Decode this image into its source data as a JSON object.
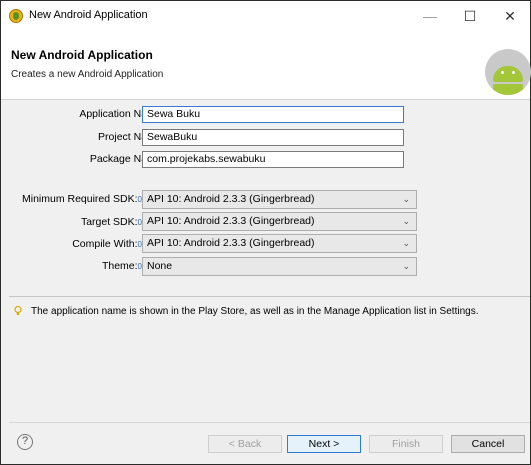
{
  "window": {
    "title": "New Android Application"
  },
  "header": {
    "title": "New Android Application",
    "subtitle": "Creates a new Android Application"
  },
  "form": {
    "app_name_label": "Application Name:",
    "app_name_value": "Sewa Buku",
    "project_name_label": "Project Name:",
    "project_name_value": "SewaBuku",
    "package_name_label": "Package Name:",
    "package_name_value": "com.projekabs.sewabuku",
    "min_sdk_label": "Minimum Required SDK:",
    "min_sdk_value": "API 10: Android 2.3.3 (Gingerbread)",
    "target_sdk_label": "Target SDK:",
    "target_sdk_value": "API 10: Android 2.3.3 (Gingerbread)",
    "compile_with_label": "Compile With:",
    "compile_with_value": "API 10: Android 2.3.3 (Gingerbread)",
    "theme_label": "Theme:",
    "theme_value": "None",
    "info_marker": "0"
  },
  "hint": {
    "text": "The application name is shown in the Play Store, as well as in the Manage Application list in Settings."
  },
  "buttons": {
    "help": "?",
    "back": "< Back",
    "next": "Next >",
    "finish": "Finish",
    "cancel": "Cancel"
  },
  "window_controls": {
    "minimize": "—",
    "maximize": "☐",
    "close": "✕"
  }
}
